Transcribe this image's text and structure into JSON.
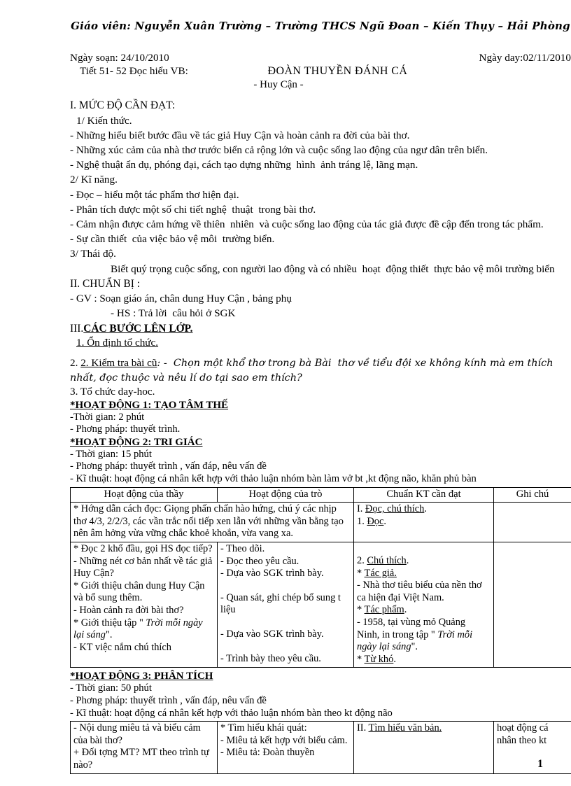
{
  "header": {
    "running_header": "Giáo viên: Nguyễn Xuân Trường – Trường THCS Ngũ Đoan – Kiến Thụy – Hải Phòng"
  },
  "meta": {
    "ngay_soan": "Ngày soạn: 24/10/2010",
    "ngay_day": "Ngày day:02/11/2010",
    "tiet": "Tiết 51- 52 Đọc hiểu VB:",
    "title": "ĐOÀN THUYỀN ĐÁNH CÁ",
    "author": "- Huy Cận -"
  },
  "section_1": {
    "heading": "I.  MỨC ĐỘ CẦN ĐẠT:",
    "sub1": "1/ Kiến thức.",
    "items1": [
      "- Những hiểu biết bước đầu về tác giả Huy Cận và hoàn cảnh ra đời của bài thơ.",
      "- Những xúc cảm của nhà thơ trước biển cả rộng lớn và cuộc sống lao động của ngư dân trên biển.",
      "- Nghệ thuật ẩn dụ, phóng đại, cách tạo dựng những  hình  ảnh tráng lệ, lãng mạn."
    ],
    "sub2": "2/ Kĩ năng.",
    "items2": [
      "- Đọc – hiểu một tác phẩm thơ hiện đại.",
      "- Phân tích được một số chi tiết nghệ  thuật  trong bài thơ.",
      "- Cảm nhận được cảm hứng về thiên  nhiên  và cuộc sống lao động của tác giả được đề cập đến trong tác phẩm.",
      "- Sự cần thiết  của việc bảo vệ môi  trường biển."
    ],
    "sub3": "3/ Thái độ.",
    "items3": [
      "Biết quý trọng cuộc sống, con người lao động và có nhiều  hoạt  động thiết  thực bảo vệ môi trường biển"
    ]
  },
  "section_2": {
    "heading": "II.  CHUẨN BỊ :",
    "gv": "- GV : Soạn giáo án, chân dung Huy Cận , bảng phụ",
    "hs": "- HS : Trả lời  câu hỏi ở SGK"
  },
  "section_3": {
    "heading_num": "III.",
    "heading": "CÁC BƯỚC   LÊN LỚP.",
    "step1": "1. Ổn định tổ chức.",
    "step2_label": "2. Kiểm tra bài cũ",
    "step2_text": ": -  Chọn một khổ thơ trong bà Bài  thơ về tiểu đội xe không kính mà em thích nhất, đọc thuộc và nêu lí do tại sao em thích?",
    "step3": "3. Tổ chức day-hoc."
  },
  "activity_1": {
    "heading": "*HOẠT ĐỘNG 1: TẠO TÂM THẾ",
    "lines": [
      "-Thời gian: 2 phút",
      "- Phơng   pháp: thuyết trình."
    ]
  },
  "activity_2": {
    "heading": "*HOẠT ĐỘNG 2: TRI GIÁC",
    "lines": [
      "- Thời gian: 15 phút",
      "- Phơng   pháp: thuyết trình , vấn đáp, nêu vấn đề",
      "- Kĩ thuật: hoạt động cá nhân kết hợp với thảo luận nhóm bàn làm vở bt ,kt động não, khăn phủ bàn"
    ]
  },
  "table_1": {
    "headers": [
      "Hoạt động của thầy",
      "Hoạt động của trò",
      "Chuẩn KT cần đạt",
      "Ghi chú"
    ],
    "rows": [
      {
        "teacher_span": "* Hớng   dẫn cách đọc: Giọng phấn chấn hào hứng, chú ý các nhịp thơ 4/3, 2/2/3, các vần trắc nối tiếp xen lẫn với những vần bằng tạo nên âm hởng   vừa vững chắc khoẻ khoắn, vừa vang xa.",
        "standard": [
          "I. Đọc, chú thích.",
          "1. Đọc."
        ],
        "note": ""
      },
      {
        "teacher": [
          "* Đọc 2 khổ đầu, gọi HS đọc tiếp?",
          "- Những nét cơ bản nhất về tác giả Huy Cận?",
          "* Giới thiệu chân dung Huy Cận và  bổ sung thêm.",
          "- Hoàn cảnh ra đời bài thơ?",
          "* Giới thiệu tập \" Trời mỗi ngày lại sáng\".",
          "- KT việc nắm chú thích"
        ],
        "student": [
          "- Theo dõi.",
          "- Đọc theo yêu cầu.",
          "- Dựa vào SGK trình bày.",
          "",
          "- Quan sát, ghi chép bổ sung t   liệu",
          "",
          "- Dựa vào SGK trình bày.",
          "",
          "- Trình bày theo yêu cầu."
        ],
        "standard": [
          "2. Chú thích.",
          "* Tác giả.",
          "- Nhà thơ tiêu biểu của nền thơ ca hiện đại Việt Nam.",
          "* Tác phẩm.",
          "- 1958, tại vùng mỏ Quảng Ninh, in trong tập \" Trời mỗi ngày lại sáng\".",
          "* Từ khó."
        ],
        "note": ""
      }
    ]
  },
  "activity_3": {
    "heading": "*HOẠT ĐỘNG 3: PHÂN TÍCH",
    "lines": [
      "- Thời gian: 50 phút",
      "- Phơng   pháp: thuyết trình , vấn đáp, nêu vấn đề",
      "- Kĩ thuật: hoạt động cá nhân kết hợp với thảo luận nhóm bàn theo kt động não"
    ]
  },
  "table_2": {
    "rows": [
      {
        "teacher": [
          "- Nội dung miêu tả và biểu cảm của bài thơ?",
          "+ Đối tợng   MT? MT theo trình tự nào?"
        ],
        "student": [
          "* Tìm hiểu khái quát:",
          "- Miêu tả kết hợp với biểu cảm.",
          "- Miêu tả: Đoàn thuyền"
        ],
        "standard": [
          "II. Tìm hiểu văn bản."
        ],
        "note": [
          "hoạt động cá nhân theo  kt"
        ]
      }
    ]
  },
  "footer": {
    "page_number": "1"
  }
}
